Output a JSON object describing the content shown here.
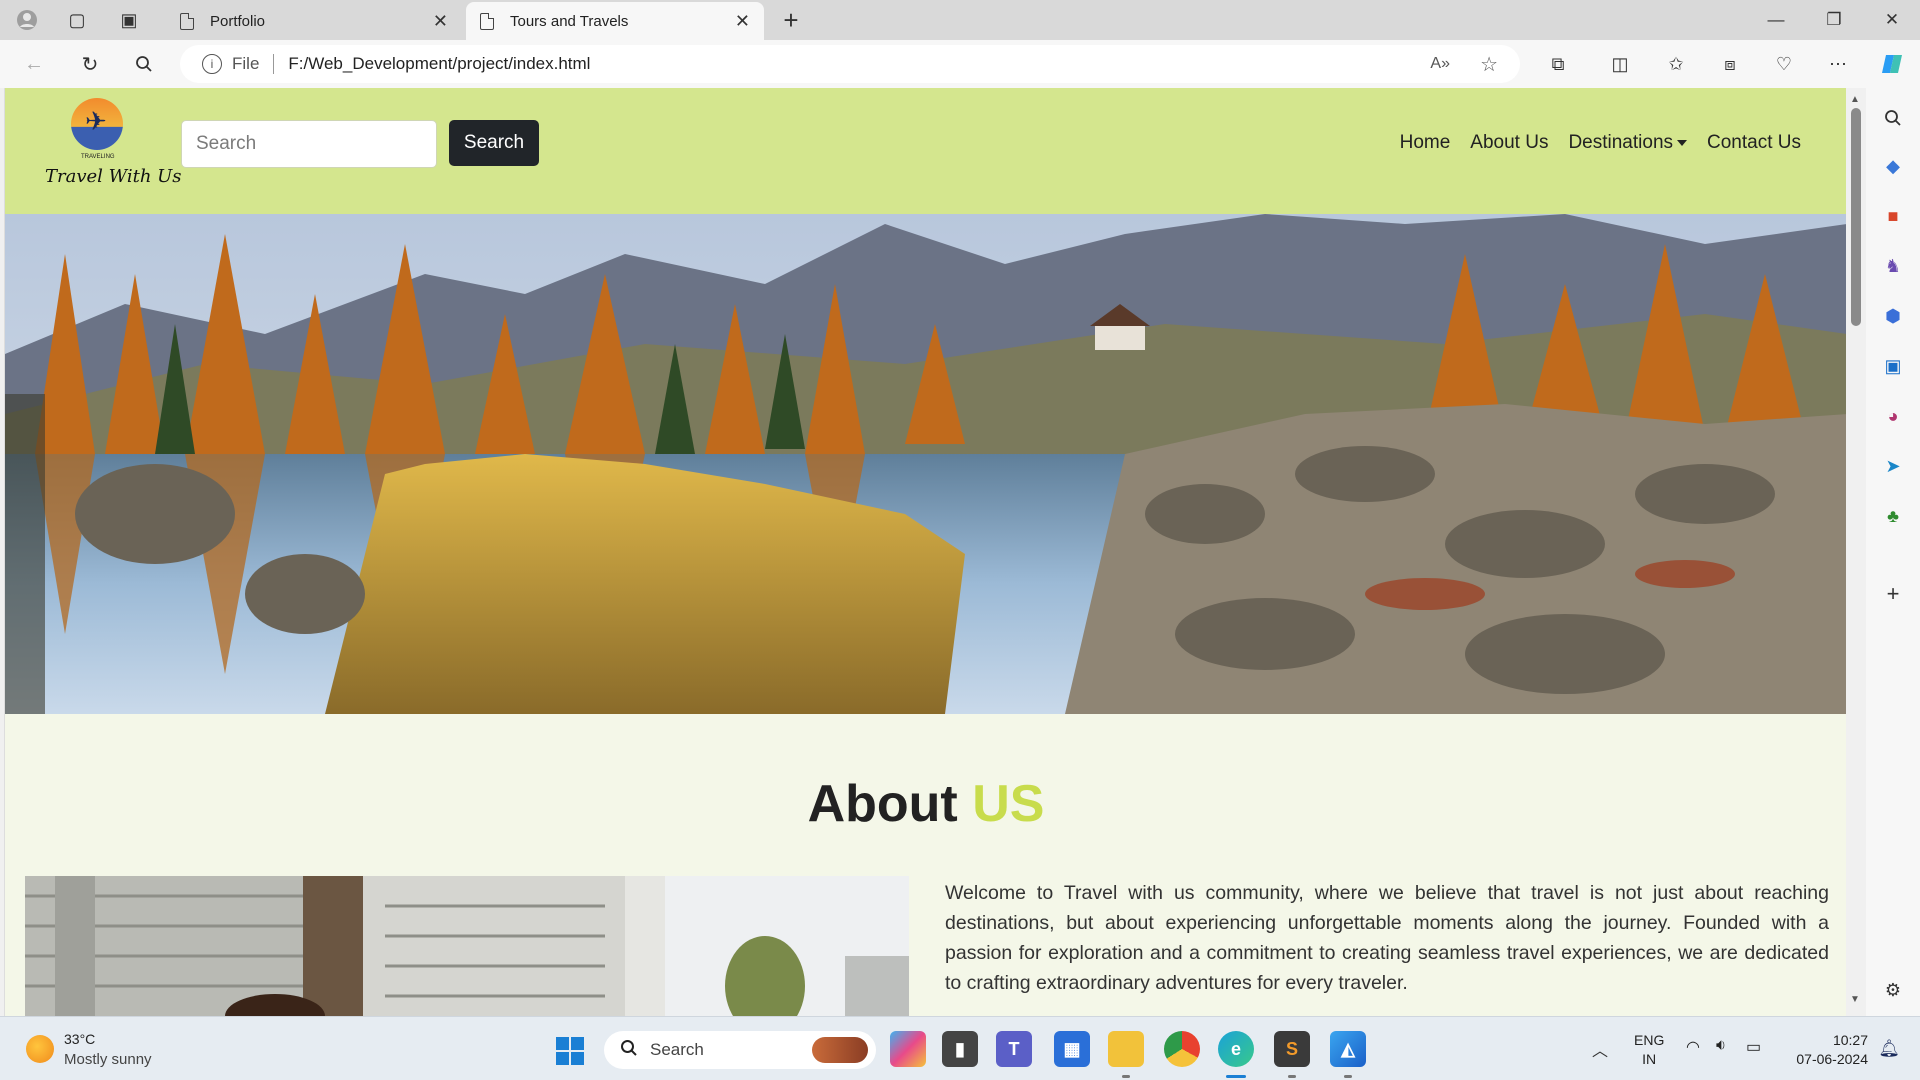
{
  "browser": {
    "tabs": [
      {
        "title": "Portfolio",
        "active": false
      },
      {
        "title": "Tours and Travels",
        "active": true
      }
    ],
    "address": {
      "security_label": "File",
      "url": "F:/Web_Development/project/index.html"
    }
  },
  "site": {
    "logo": {
      "small_text": "TRAVELING",
      "brand": "Travel With Us"
    },
    "search": {
      "placeholder": "Search",
      "button": "Search"
    },
    "menu": {
      "home": "Home",
      "about": "About Us",
      "destinations": "Destinations",
      "contact": "Contact Us"
    },
    "about": {
      "title_main": "About",
      "title_accent": "US",
      "paragraph": "Welcome to Travel with us community, where we believe that travel is not just about reaching destinations, but about experiencing unforgettable moments along the journey. Founded with a passion for exploration and a commitment to creating seamless travel experiences, we are dedicated to crafting extraordinary adventures for every traveler."
    }
  },
  "taskbar": {
    "weather": {
      "temp": "33°C",
      "desc": "Mostly sunny"
    },
    "search_label": "Search",
    "lang": {
      "line1": "ENG",
      "line2": "IN"
    },
    "clock": {
      "time": "10:27",
      "date": "07-06-2024"
    }
  },
  "colors": {
    "nav_bg": "#d4e68e",
    "accent": "#c8dc4c",
    "page_bg": "#f4f7e8",
    "dark_button": "#212529"
  }
}
